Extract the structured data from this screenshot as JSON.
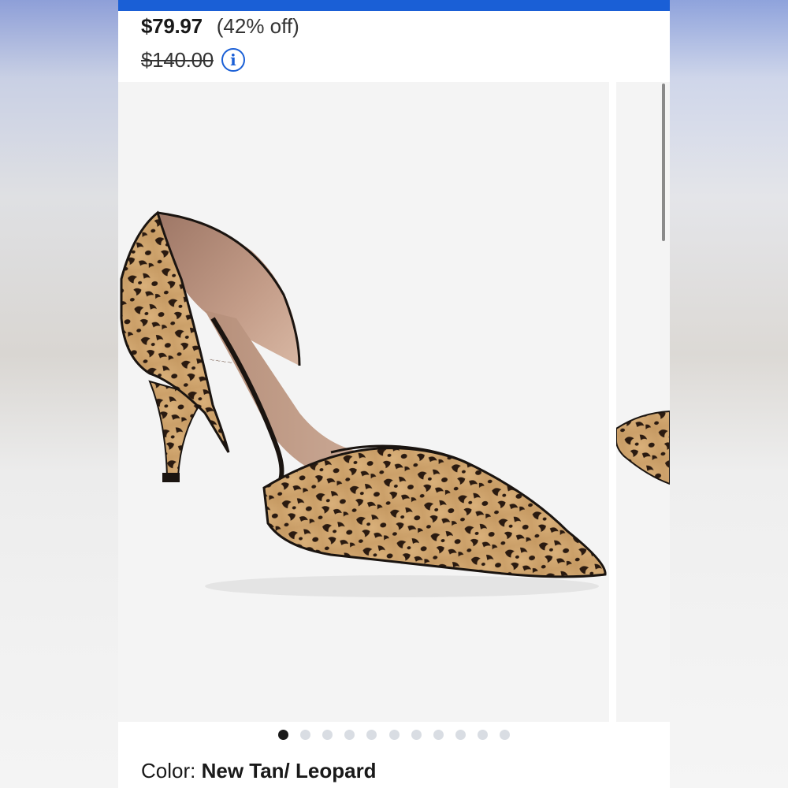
{
  "product": {
    "price_current": "$79.97",
    "price_discount": "(42% off)",
    "price_original": "$140.00",
    "color_label": "Color:",
    "color_value": "New Tan/ Leopard"
  },
  "icons": {
    "info": "info-circle-icon"
  },
  "carousel": {
    "image_count": 11,
    "active_index": 0,
    "image_subject": "leopard print pointed-toe d'Orsay pump"
  },
  "colors": {
    "accent": "#1a5fd6",
    "text": "#191919",
    "dot_inactive": "#d9dde3",
    "image_bg": "#f4f4f4"
  }
}
